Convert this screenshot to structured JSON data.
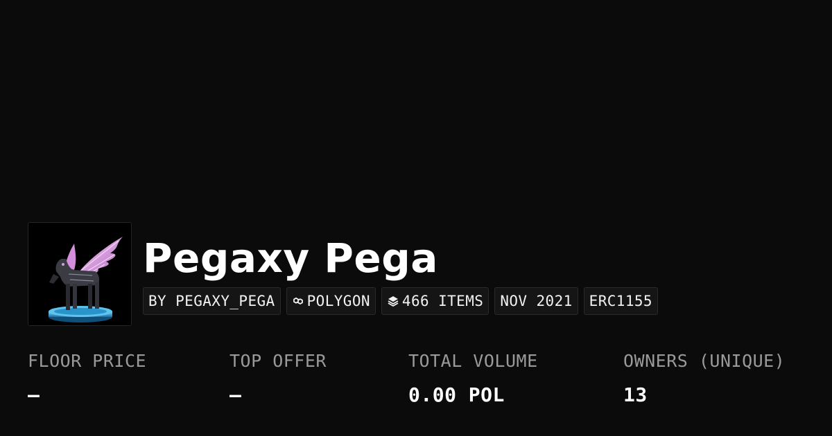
{
  "collection": {
    "title": "Pegaxy Pega",
    "chips": {
      "creator": "BY PEGAXY_PEGA",
      "chain": "POLYGON",
      "items": "466 ITEMS",
      "date": "NOV 2021",
      "standard": "ERC1155"
    },
    "icons": {
      "chain": "polygon-icon",
      "items": "layers-icon"
    }
  },
  "stats": [
    {
      "label": "FLOOR PRICE",
      "value": "–"
    },
    {
      "label": "TOP OFFER",
      "value": "–"
    },
    {
      "label": "TOTAL VOLUME",
      "value": "0.00 POL"
    },
    {
      "label": "OWNERS (UNIQUE)",
      "value": "13"
    }
  ],
  "colors": {
    "background": "#0b0b0b",
    "chip_background": "#151515",
    "label_gray": "#9a9a9a",
    "wing_pink": "#e6a3e8",
    "pedestal_blue": "#34a6d8"
  }
}
